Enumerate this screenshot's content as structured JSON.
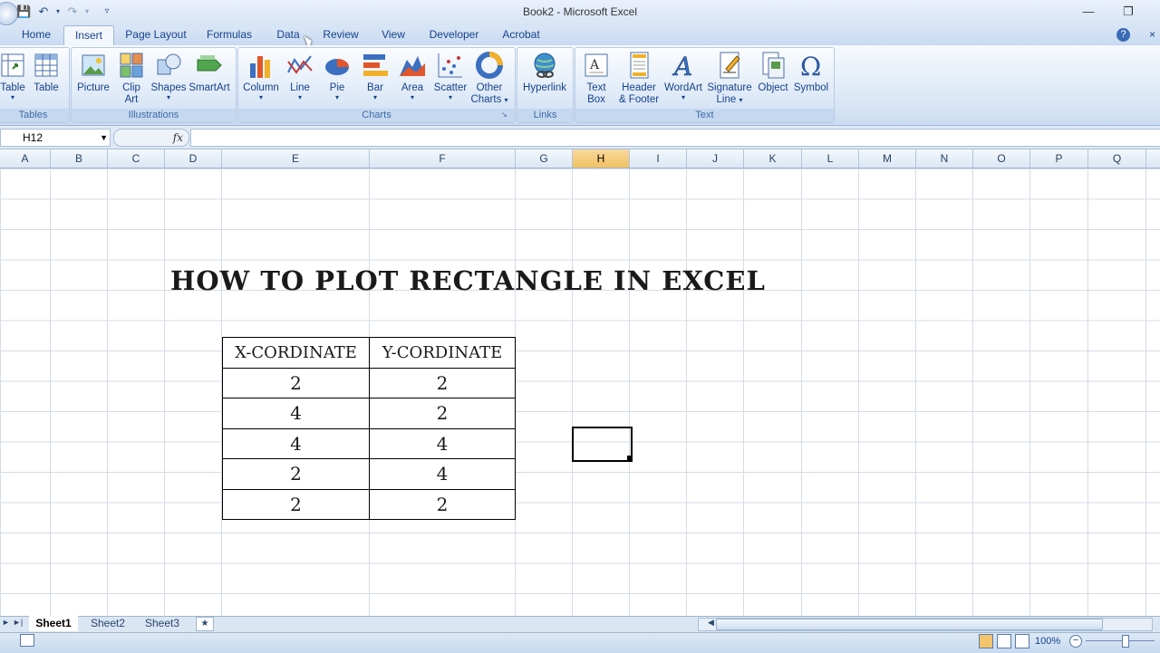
{
  "window": {
    "title": "Book2 - Microsoft Excel"
  },
  "tabs": [
    "Home",
    "Insert",
    "Page Layout",
    "Formulas",
    "Data",
    "Review",
    "View",
    "Developer",
    "Acrobat"
  ],
  "active_tab": "Insert",
  "ribbon": {
    "groups": {
      "tables": "Tables",
      "illustrations": "Illustrations",
      "charts": "Charts",
      "links": "Links",
      "text": "Text"
    },
    "buttons": {
      "pivot_table": "Table",
      "table": "Table",
      "picture": "Picture",
      "clip_art_1": "Clip",
      "clip_art_2": "Art",
      "shapes": "Shapes",
      "smartart": "SmartArt",
      "column": "Column",
      "line": "Line",
      "pie": "Pie",
      "bar": "Bar",
      "area": "Area",
      "scatter": "Scatter",
      "other_1": "Other",
      "other_2": "Charts",
      "hyperlink": "Hyperlink",
      "textbox_1": "Text",
      "textbox_2": "Box",
      "header_1": "Header",
      "header_2": "& Footer",
      "wordart": "WordArt",
      "signature_1": "Signature",
      "signature_2": "Line",
      "object": "Object",
      "symbol": "Symbol"
    }
  },
  "formula_bar": {
    "name_box": "H12",
    "fx": "fx",
    "formula": ""
  },
  "columns": [
    "A",
    "B",
    "C",
    "D",
    "E",
    "F",
    "G",
    "H",
    "I",
    "J",
    "K",
    "L",
    "M",
    "N",
    "O",
    "P",
    "Q"
  ],
  "selected_column": "H",
  "sheet": {
    "title": "HOW TO PLOT RECTANGLE IN EXCEL",
    "headers": [
      "X-CORDINATE",
      "Y-CORDINATE"
    ],
    "rows": [
      [
        "2",
        "2"
      ],
      [
        "4",
        "2"
      ],
      [
        "4",
        "4"
      ],
      [
        "2",
        "4"
      ],
      [
        "2",
        "2"
      ]
    ]
  },
  "sheet_tabs": [
    "Sheet1",
    "Sheet2",
    "Sheet3"
  ],
  "active_sheet": "Sheet1",
  "status": {
    "zoom": "100%"
  }
}
